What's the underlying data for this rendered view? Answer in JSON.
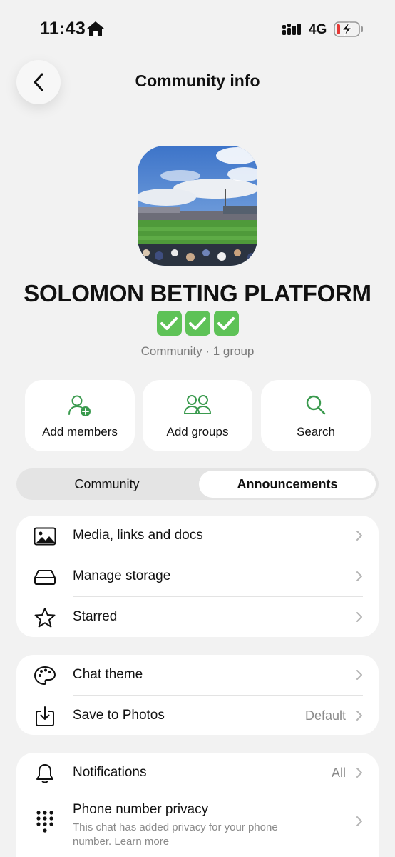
{
  "status_bar": {
    "time": "11:43",
    "network": "4G"
  },
  "header": {
    "title": "Community info"
  },
  "profile": {
    "name": "SOLOMON BETING PLATFORM",
    "subtitle": "Community · 1 group"
  },
  "actions": [
    {
      "label": "Add members",
      "icon": "add-person-icon"
    },
    {
      "label": "Add groups",
      "icon": "people-icon"
    },
    {
      "label": "Search",
      "icon": "search-icon"
    }
  ],
  "segment": {
    "left": "Community",
    "right": "Announcements",
    "selected": "Announcements"
  },
  "group1": [
    {
      "label": "Media, links and docs",
      "icon": "image-icon"
    },
    {
      "label": "Manage storage",
      "icon": "storage-icon"
    },
    {
      "label": "Starred",
      "icon": "star-icon"
    }
  ],
  "group2": [
    {
      "label": "Chat theme",
      "icon": "palette-icon",
      "value": ""
    },
    {
      "label": "Save to Photos",
      "icon": "download-icon",
      "value": "Default"
    }
  ],
  "group3": [
    {
      "label": "Notifications",
      "icon": "bell-icon",
      "value": "All"
    },
    {
      "label": "Phone number privacy",
      "icon": "dialpad-icon",
      "description": "This chat has added privacy for your phone number. Learn more"
    }
  ],
  "colors": {
    "accent_green": "#3a9a4e",
    "background": "#f2f2f2",
    "card": "#ffffff",
    "check_green": "#5ec257"
  }
}
